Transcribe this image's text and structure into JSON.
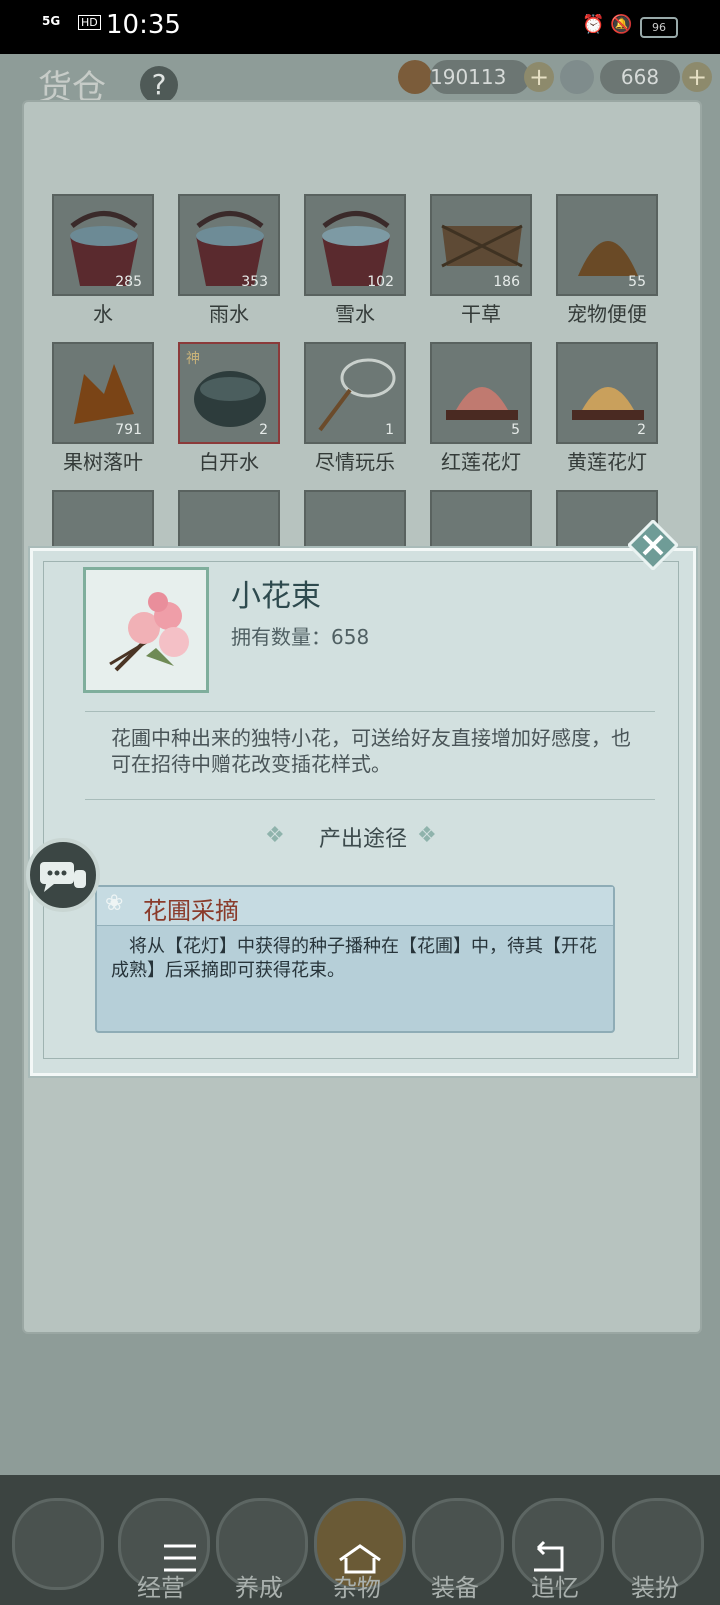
{
  "status_bar": {
    "network": "5G",
    "hd": "HD",
    "time": "10:35",
    "battery": "96"
  },
  "header": {
    "title": "货仓",
    "help": "?",
    "copper_coins": "190113",
    "silver": "668"
  },
  "inventory": {
    "rows": [
      [
        {
          "label": "水",
          "count": "285"
        },
        {
          "label": "雨水",
          "count": "353"
        },
        {
          "label": "雪水",
          "count": "102"
        },
        {
          "label": "干草",
          "count": "186"
        },
        {
          "label": "宠物便便",
          "count": "55"
        }
      ],
      [
        {
          "label": "果树落叶",
          "count": "791"
        },
        {
          "label": "白开水",
          "count": "2",
          "badge": "神"
        },
        {
          "label": "尽情玩乐",
          "count": "1"
        },
        {
          "label": "红莲花灯",
          "count": "5"
        },
        {
          "label": "黄莲花灯",
          "count": "2"
        }
      ]
    ]
  },
  "modal": {
    "item_name": "小花束",
    "qty_label": "拥有数量：658",
    "description": "花圃中种出来的独特小花，可送给好友直接增加好感度，也可在招待中赠花改变插花样式。",
    "source_title": "产出途径",
    "source_name": "花圃采摘",
    "source_desc": "　将从【花灯】中获得的种子播种在【花圃】中，待其【开花成熟】后采摘即可获得花束。"
  },
  "dock": {
    "labels": [
      "经营",
      "养成",
      "杂物",
      "装备",
      "追忆",
      "装扮"
    ]
  },
  "colors": {
    "accent": "#8a3b2b",
    "modal_bg": "#d2e0df"
  }
}
